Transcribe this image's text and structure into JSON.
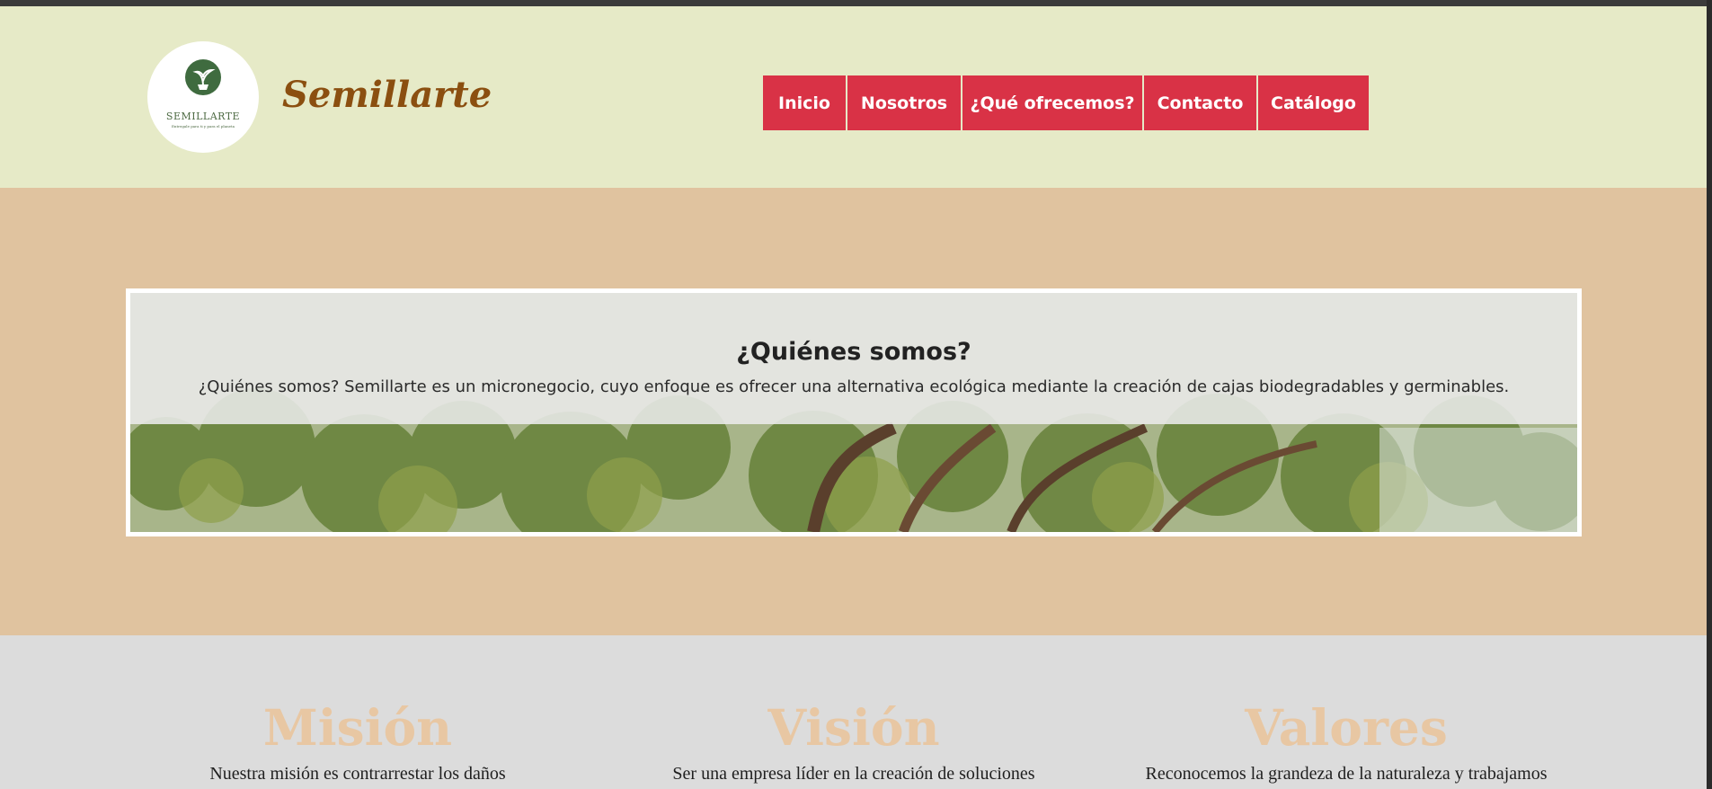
{
  "header": {
    "logo_text": "SEMILLARTE",
    "logo_subtext": "Entregale para ti y para el planeta",
    "brand": "Semillarte",
    "nav": [
      "Inicio",
      "Nosotros",
      "¿Qué ofrecemos?",
      "Contacto",
      "Catálogo"
    ]
  },
  "about": {
    "title": "¿Quiénes somos?",
    "text": "¿Quiénes somos? Semillarte es un micronegocio, cuyo enfoque es ofrecer una alternativa ecológica mediante la creación de cajas biodegradables y germinables."
  },
  "sections": [
    {
      "title": "Misión",
      "text": "Nuestra misión es contrarrestar los daños"
    },
    {
      "title": "Visión",
      "text": "Ser una empresa líder en la creación de soluciones"
    },
    {
      "title": "Valores",
      "text": "Reconocemos la grandeza de la naturaleza y trabajamos"
    }
  ],
  "colors": {
    "header_bg": "#e6eac7",
    "nav_bg": "#d93246",
    "about_bg": "#e0c39f",
    "section_title": "#e8c7a3",
    "brand_text": "#8b4f10"
  }
}
